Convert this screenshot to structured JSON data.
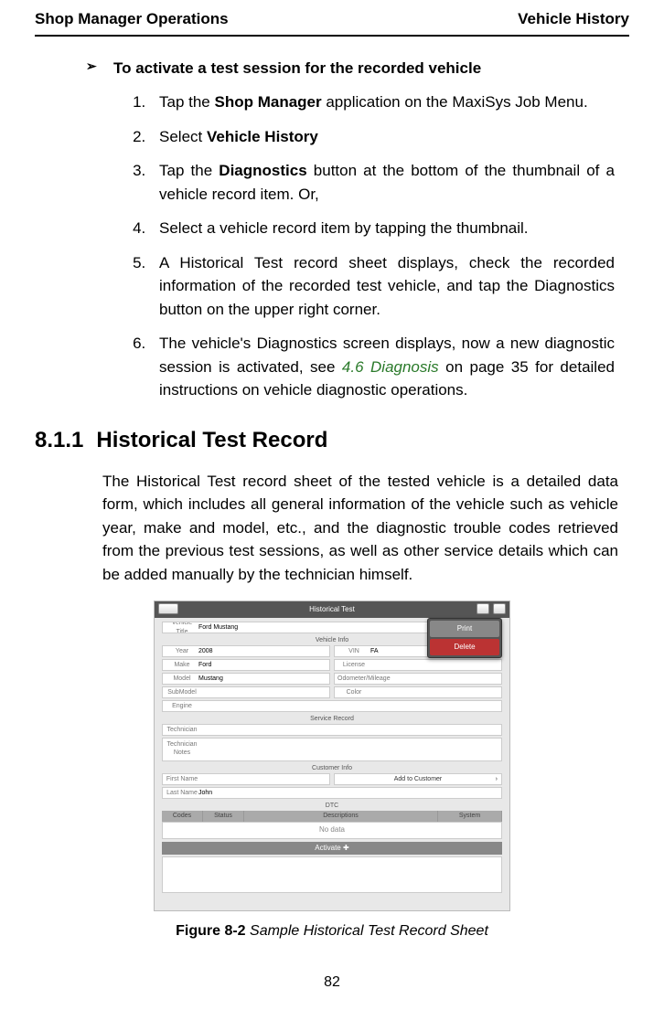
{
  "header": {
    "left": "Shop Manager Operations",
    "right": "Vehicle History"
  },
  "bullet": {
    "mark": "➢",
    "text": "To activate a test session for the recorded vehicle"
  },
  "steps": {
    "s1a": "Tap the ",
    "s1b": "Shop Manager",
    "s1c": " application on the MaxiSys Job Menu.",
    "s2a": "Select ",
    "s2b": "Vehicle History",
    "s3a": "Tap the ",
    "s3b": "Diagnostics",
    "s3c": " button at the bottom of the thumbnail of a vehicle record item. Or,",
    "s4": "Select a vehicle record item by tapping the thumbnail.",
    "s5": "A Historical Test record sheet displays, check the recorded information of the recorded test vehicle, and tap the Diagnostics button on the upper right corner.",
    "s6a": "The vehicle's Diagnostics screen displays, now a new diagnostic session is activated, see ",
    "s6b": "4.6 Diagnosis",
    "s6c": " on page 35 for detailed instructions on vehicle diagnostic operations."
  },
  "subheading": {
    "num": "8.1.1",
    "title": "Historical Test Record"
  },
  "para": "The Historical Test record sheet of the tested vehicle is a detailed data form, which includes all general information of the vehicle such as vehicle year, make and model, etc., and the diagnostic trouble codes retrieved from the previous test sessions, as well as other service details which can be added manually by the technician himself.",
  "figure": {
    "title": "Historical Test",
    "menu": {
      "print": "Print",
      "delete": "Delete"
    },
    "vehicleTitleLabel": "Vehicle Title",
    "vehicleTitle": "Ford Mustang",
    "vehicleInfoLabel": "Vehicle Info",
    "fields": {
      "yearL": "Year",
      "year": "2008",
      "makeL": "Make",
      "make": "Ford",
      "modelL": "Model",
      "model": "Mustang",
      "subModelL": "SubModel",
      "engineL": "Engine",
      "vinL": "VIN",
      "vin": "FA",
      "licenseL": "License",
      "odoL": "Odometer/Mileage",
      "colorL": "Color"
    },
    "serviceRecordLabel": "Service Record",
    "technicianL": "Technician",
    "techNotesL": "Technician Notes",
    "customerInfoLabel": "Customer Info",
    "firstNameL": "First Name",
    "lastNameL": "Last Name",
    "lastName": "John",
    "addCustomer": "Add to Customer",
    "dtcLabel": "DTC",
    "dtc": {
      "codes": "Codes",
      "status": "Status",
      "desc": "Descriptions",
      "system": "System"
    },
    "noData": "No data",
    "activate": "Activate ✚"
  },
  "caption": {
    "label": "Figure 8-2",
    "text": " Sample Historical Test Record Sheet"
  },
  "pageNumber": "82"
}
